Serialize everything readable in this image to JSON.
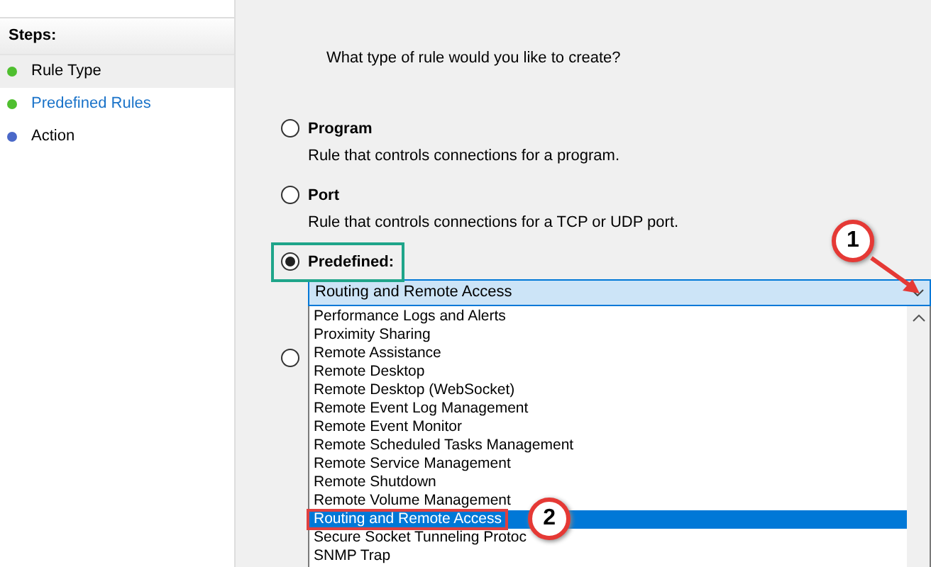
{
  "steps": {
    "title": "Steps:",
    "items": [
      {
        "label": "Rule Type",
        "selected": true,
        "link": false,
        "color": "#4fbf2f"
      },
      {
        "label": "Predefined Rules",
        "selected": false,
        "link": true,
        "color": "#4fbf2f"
      },
      {
        "label": "Action",
        "selected": false,
        "link": false,
        "color": "#4a68c8"
      }
    ]
  },
  "question": "What type of rule would you like to create?",
  "options": [
    {
      "kind": "described",
      "label": "Program",
      "description": "Rule that controls connections for a program.",
      "selected": false
    },
    {
      "kind": "described",
      "label": "Port",
      "description": "Rule that controls connections for a TCP or UDP port.",
      "selected": false
    },
    {
      "kind": "dropdown",
      "label": "Predefined:",
      "selected": true
    },
    {
      "kind": "hidden",
      "selected": false
    }
  ],
  "dropdown": {
    "value": "Routing and Remote Access",
    "expanded": true,
    "items": [
      {
        "label": "Performance Logs and Alerts",
        "selected": false
      },
      {
        "label": "Proximity Sharing",
        "selected": false
      },
      {
        "label": "Remote Assistance",
        "selected": false
      },
      {
        "label": "Remote Desktop",
        "selected": false
      },
      {
        "label": "Remote Desktop (WebSocket)",
        "selected": false
      },
      {
        "label": "Remote Event Log Management",
        "selected": false
      },
      {
        "label": "Remote Event Monitor",
        "selected": false
      },
      {
        "label": "Remote Scheduled Tasks Management",
        "selected": false
      },
      {
        "label": "Remote Service Management",
        "selected": false
      },
      {
        "label": "Remote Shutdown",
        "selected": false
      },
      {
        "label": "Remote Volume Management",
        "selected": false
      },
      {
        "label": "Routing and Remote Access",
        "selected": true
      },
      {
        "label": "Secure Socket Tunneling Protoc",
        "selected": false
      },
      {
        "label": "SNMP Trap",
        "selected": false
      }
    ]
  },
  "callouts": [
    {
      "label": "1"
    },
    {
      "label": "2"
    }
  ]
}
